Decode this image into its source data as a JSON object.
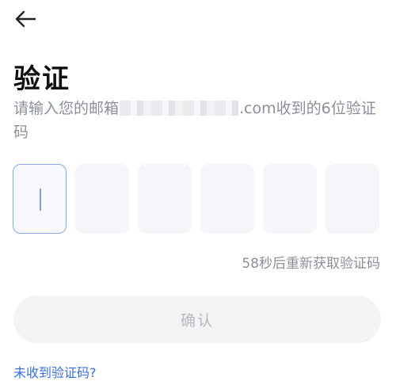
{
  "header": {
    "back_icon": "arrow-left-icon"
  },
  "title": "验证",
  "subtitle": {
    "prefix": "请输入您的邮箱",
    "email_suffix": ".com",
    "suffix": "收到的6位验证码"
  },
  "code_input": {
    "length": 6,
    "active_index": 0,
    "values": [
      "",
      "",
      "",
      "",
      "",
      ""
    ]
  },
  "resend": {
    "countdown": "58",
    "label": "秒后重新获取验证码"
  },
  "confirm_button": {
    "label": "确认",
    "enabled": false
  },
  "help_link": "未收到验证码?",
  "colors": {
    "accent": "#3a6fd8",
    "box_active_border": "#8aa9e0",
    "box_bg": "#f4f6f9",
    "muted_text": "#8a8f99",
    "button_disabled_bg": "#f3f4f6",
    "button_disabled_text": "#b4b8bf"
  }
}
